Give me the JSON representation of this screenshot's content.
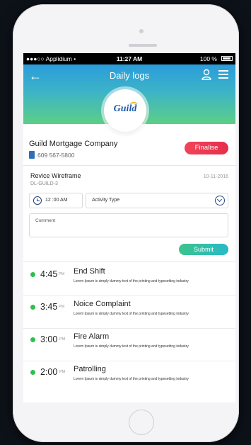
{
  "status_bar": {
    "carrier": "●●●○○ Applidium •",
    "time": "11:27 AM",
    "battery": "100 %"
  },
  "header": {
    "title": "Daily logs",
    "back_icon": "arrow-left-icon",
    "user_icon": "user-icon",
    "menu_icon": "menu-icon"
  },
  "logo": {
    "text": "Guild"
  },
  "company": {
    "name": "Guild Mortgage Company",
    "phone": "609 567-5800",
    "finalise_label": "Finalise"
  },
  "log_form": {
    "title": "Revice Wireframe",
    "code": "DL-GUILD-3",
    "date": "10-11-2016",
    "time_value": "12 :00 AM",
    "activity_placeholder": "Activity Type",
    "comment_placeholder": "Comment",
    "submit_label": "Submit"
  },
  "log_items": [
    {
      "time": "4:45",
      "ampm": "PM",
      "title": "End Shift",
      "description": "Lorem Ipsum is simply dummy text of the printing and typesetting industry"
    },
    {
      "time": "3:45",
      "ampm": "PM",
      "title": "Noice Complaint",
      "description": "Lorem Ipsum is simply dummy text of the printing and typesetting industry"
    },
    {
      "time": "3:00",
      "ampm": "PM",
      "title": "Fire Alarm",
      "description": "Lorem Ipsum is simply dummy text of the printing and typesetting industry"
    },
    {
      "time": "2:00",
      "ampm": "PM",
      "title": "Patrolling",
      "description": "Lorem Ipsum is simply dummy text of the printing and typesetting industry"
    }
  ],
  "colors": {
    "accent_red": "#e62e4b",
    "accent_green": "#3bc48c",
    "status_dot": "#2fbf4f",
    "header_top": "#2b9cdb",
    "header_bottom": "#5ccf86"
  }
}
